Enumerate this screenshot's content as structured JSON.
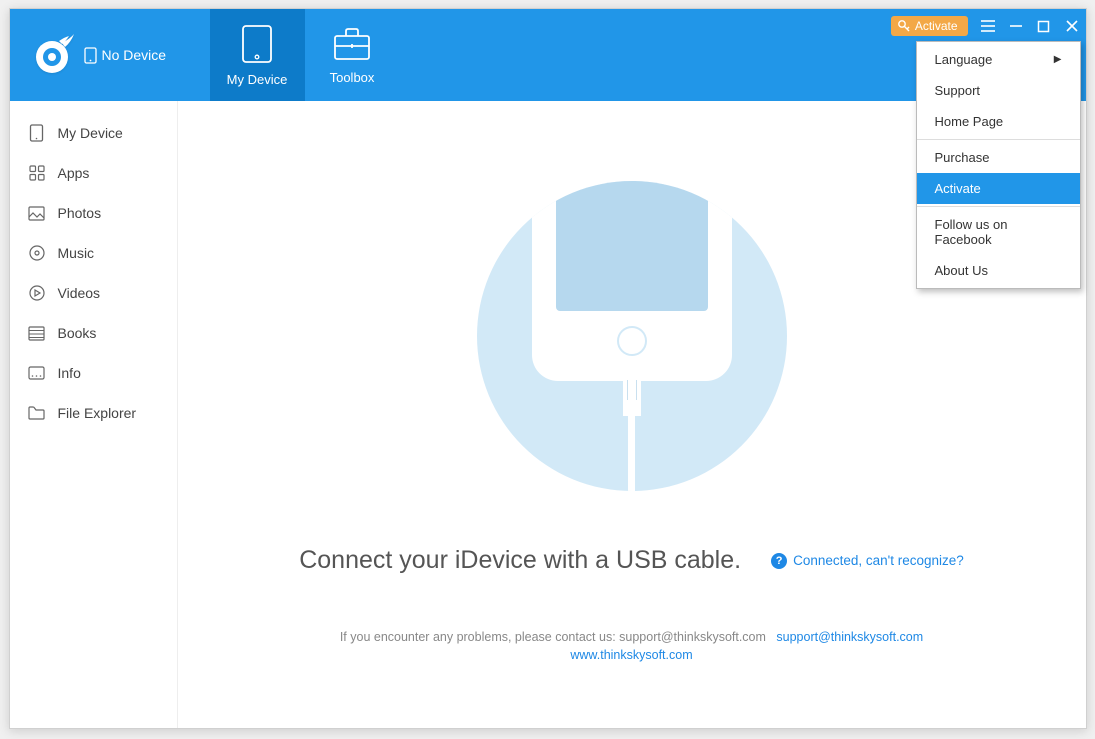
{
  "header": {
    "no_device_label": "No Device",
    "tabs": [
      {
        "label": "My Device",
        "icon": "tablet"
      },
      {
        "label": "Toolbox",
        "icon": "briefcase"
      }
    ],
    "activate_button": "Activate"
  },
  "sidebar": {
    "items": [
      {
        "label": "My Device",
        "icon": "device"
      },
      {
        "label": "Apps",
        "icon": "apps"
      },
      {
        "label": "Photos",
        "icon": "photos"
      },
      {
        "label": "Music",
        "icon": "music"
      },
      {
        "label": "Videos",
        "icon": "videos"
      },
      {
        "label": "Books",
        "icon": "books"
      },
      {
        "label": "Info",
        "icon": "info"
      },
      {
        "label": "File Explorer",
        "icon": "folder"
      }
    ]
  },
  "main": {
    "connect_text": "Connect your iDevice with a USB cable.",
    "help_link": "Connected, can't recognize?",
    "footer_prefix": "If you encounter any problems, please contact us: support@thinkskysoft.com",
    "footer_email": "support@thinkskysoft.com",
    "footer_url": "www.thinkskysoft.com"
  },
  "dropdown": {
    "items": [
      {
        "label": "Language",
        "arrow": true
      },
      {
        "label": "Support"
      },
      {
        "label": "Home Page"
      },
      {
        "sep": true
      },
      {
        "label": "Purchase"
      },
      {
        "label": "Activate",
        "highlighted": true
      },
      {
        "sep": true
      },
      {
        "label": "Follow us on Facebook"
      },
      {
        "label": "About Us"
      }
    ]
  }
}
